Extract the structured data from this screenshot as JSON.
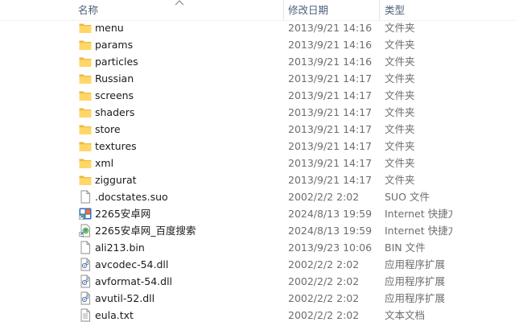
{
  "columns": {
    "name": "名称",
    "date": "修改日期",
    "type": "类型"
  },
  "files": [
    {
      "name": "menu",
      "date": "2013/9/21 14:16",
      "type": "文件夹",
      "icon": "folder-icon"
    },
    {
      "name": "params",
      "date": "2013/9/21 14:16",
      "type": "文件夹",
      "icon": "folder-icon"
    },
    {
      "name": "particles",
      "date": "2013/9/21 14:16",
      "type": "文件夹",
      "icon": "folder-icon"
    },
    {
      "name": "Russian",
      "date": "2013/9/21 14:17",
      "type": "文件夹",
      "icon": "folder-icon"
    },
    {
      "name": "screens",
      "date": "2013/9/21 14:17",
      "type": "文件夹",
      "icon": "folder-icon"
    },
    {
      "name": "shaders",
      "date": "2013/9/21 14:17",
      "type": "文件夹",
      "icon": "folder-icon"
    },
    {
      "name": "store",
      "date": "2013/9/21 14:17",
      "type": "文件夹",
      "icon": "folder-icon"
    },
    {
      "name": "textures",
      "date": "2013/9/21 14:17",
      "type": "文件夹",
      "icon": "folder-icon"
    },
    {
      "name": "xml",
      "date": "2013/9/21 14:17",
      "type": "文件夹",
      "icon": "folder-icon"
    },
    {
      "name": "ziggurat",
      "date": "2013/9/21 14:17",
      "type": "文件夹",
      "icon": "folder-icon"
    },
    {
      "name": ".docstates.suo",
      "date": "2002/2/2 2:02",
      "type": "SUO 文件",
      "icon": "blank-file-icon"
    },
    {
      "name": "2265安卓网",
      "date": "2024/8/13 19:59",
      "type": "Internet 快捷方式",
      "icon": "internet-shortcut-icon"
    },
    {
      "name": "2265安卓网_百度搜索",
      "date": "2024/8/13 19:59",
      "type": "Internet 快捷方式",
      "icon": "internet-shortcut-search-icon"
    },
    {
      "name": "ali213.bin",
      "date": "2013/9/23 10:06",
      "type": "BIN 文件",
      "icon": "blank-file-icon"
    },
    {
      "name": "avcodec-54.dll",
      "date": "2002/2/2 2:02",
      "type": "应用程序扩展",
      "icon": "dll-file-icon"
    },
    {
      "name": "avformat-54.dll",
      "date": "2002/2/2 2:02",
      "type": "应用程序扩展",
      "icon": "dll-file-icon"
    },
    {
      "name": "avutil-52.dll",
      "date": "2002/2/2 2:02",
      "type": "应用程序扩展",
      "icon": "dll-file-icon"
    },
    {
      "name": "eula.txt",
      "date": "2002/2/2 2:02",
      "type": "文本文档",
      "icon": "text-file-icon"
    }
  ],
  "colors": {
    "header_text": "#4c607a",
    "folder_front": "#ffd767",
    "folder_back": "#e8b53d",
    "muted_text": "#6d6d6d"
  }
}
